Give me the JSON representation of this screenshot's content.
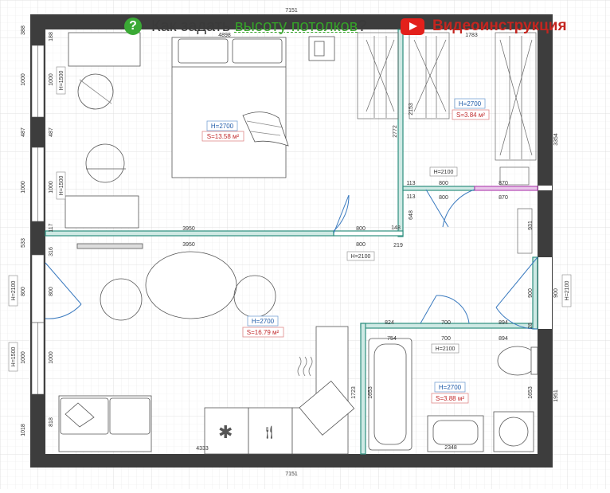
{
  "header": {
    "help_icon": "question-circle-icon",
    "help_mark": "?",
    "help_pre": "Как задать ",
    "help_link": "высоту потолков",
    "help_post": "?",
    "video_icon": "youtube-play-icon",
    "video_label": "Видеоинструкция"
  },
  "colors": {
    "wall_fill": "#3d3d3d",
    "partition": "#2f8f7f",
    "height_tag": "#1e5aa8",
    "area_tag": "#c0282a",
    "brand_green": "#35a229",
    "youtube_red": "#e3201b"
  },
  "rooms": {
    "bedroom": {
      "height": "H=2700",
      "area": "S=13.58 м²"
    },
    "wardrobe": {
      "height": "H=2700",
      "area": "S=3.84 м²"
    },
    "living": {
      "height": "H=2700",
      "area": "S=16.79 м²"
    },
    "bathroom": {
      "height": "H=2700",
      "area": "S=3.88 м²"
    }
  },
  "door_heights": {
    "bedroom": "H=2100",
    "wardrobe": "H=2100",
    "entrance": "H=2100",
    "bathroom": "H=2100"
  },
  "window_heights": {
    "bedroom_top": "H=1500",
    "bedroom_bottom": "H=1500",
    "balcony_door": "H=2100",
    "living": "H=1500"
  },
  "dimensions": {
    "total_width_top": "7151",
    "total_width_bottom": "7151",
    "bedroom_width": "4898",
    "wardrobe_width": "1783",
    "left_outer": [
      "388",
      "1000",
      "487",
      "1000",
      "533",
      "800",
      "1000",
      "1018"
    ],
    "left_inner": [
      "188",
      "1000",
      "487",
      "1000",
      "117",
      "316",
      "800",
      "1000",
      "818"
    ],
    "right_outer": [
      "3354",
      "900",
      "1951"
    ],
    "right_inner": [
      "931",
      "900",
      "28",
      "1653"
    ],
    "wardrobe_wall_v": "2153",
    "corridor_v": "2772",
    "corridor_small": [
      "113",
      "113",
      "648"
    ],
    "wardrobe_door": [
      "800",
      "800",
      "870",
      "870"
    ],
    "bedroom_wall": [
      "3950",
      "3950",
      "800",
      "800",
      "148",
      "219"
    ],
    "bathroom_top": [
      "824",
      "700",
      "894",
      "700",
      "894"
    ],
    "bathroom_inner": [
      "754",
      "1653",
      "2348"
    ],
    "kitchen": [
      "1723",
      "4333"
    ]
  }
}
